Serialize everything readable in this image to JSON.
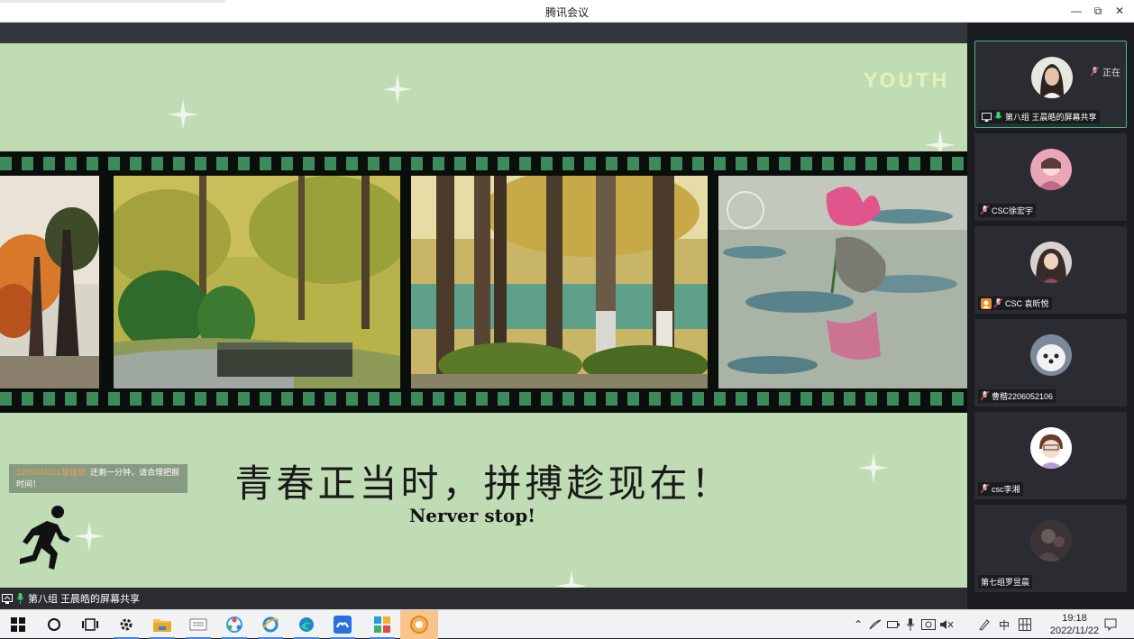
{
  "window": {
    "title": "腾讯会议"
  },
  "slide": {
    "badge": "YOUTH",
    "slogan": "青春正当时，拼搏趁现在！",
    "subtitle": "Nerver stop!"
  },
  "chat": {
    "sender": "2206004101黎娅琪:",
    "message": " 还剩一分钟，请合理把握时间！"
  },
  "share_label": "第八组 王晨皓的屏幕共享",
  "participants": [
    {
      "name": "第八组 王晨皓的屏幕共享",
      "speaking_text": "正在"
    },
    {
      "name": "CSC徐宏宇"
    },
    {
      "name": "CSC 袁昕悦"
    },
    {
      "name": "曹楷2206052106"
    },
    {
      "name": "csc李湘"
    },
    {
      "name": "第七组罗昱晨"
    }
  ],
  "taskbar": {
    "ime_mode": "中",
    "clock_time": "19:18",
    "clock_date": "2022/11/22"
  },
  "colors": {
    "slide_bg": "#bfdcb4",
    "film_hole": "#3d8a5c",
    "active_tile_border": "#3fbf7a",
    "chat_sender": "#f0a050"
  }
}
